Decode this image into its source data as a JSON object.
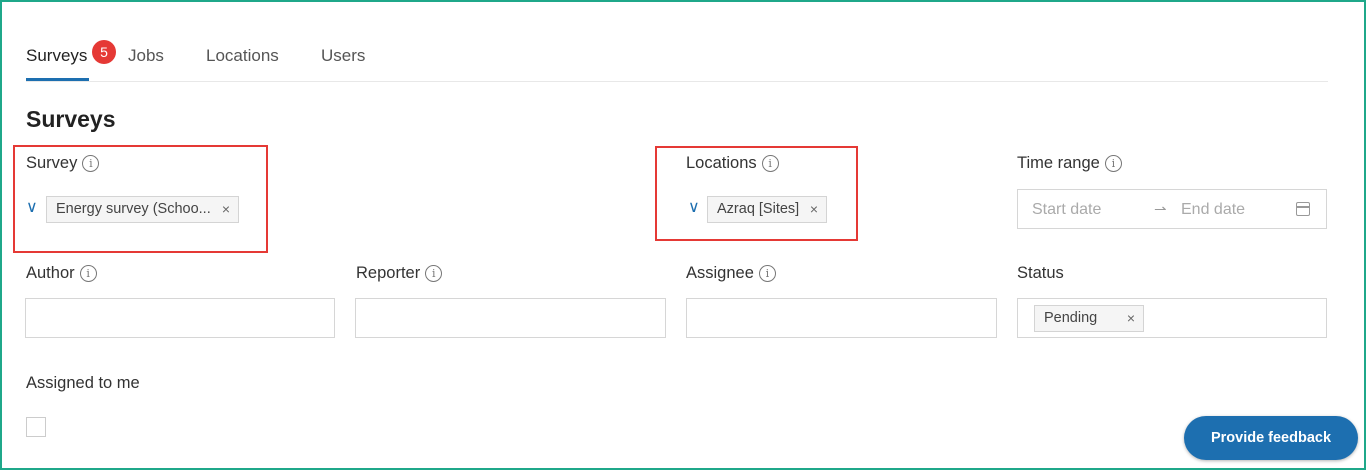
{
  "tabs": [
    {
      "label": "Surveys",
      "badge": "5",
      "active": true
    },
    {
      "label": "Jobs"
    },
    {
      "label": "Locations"
    },
    {
      "label": "Users"
    }
  ],
  "page_title": "Surveys",
  "filters": {
    "survey": {
      "label": "Survey",
      "selected": "Energy survey (Schoo...",
      "icon": "info-icon"
    },
    "locations": {
      "label": "Locations",
      "selected": "Azraq [Sites]",
      "icon": "info-icon"
    },
    "time_range": {
      "label": "Time range",
      "start_placeholder": "Start date",
      "end_placeholder": "End date",
      "icon": "calendar-icon"
    },
    "author": {
      "label": "Author",
      "value": ""
    },
    "reporter": {
      "label": "Reporter",
      "value": ""
    },
    "assignee": {
      "label": "Assignee",
      "value": ""
    },
    "status": {
      "label": "Status",
      "selected": "Pending"
    },
    "assigned_to_me": {
      "label": "Assigned to me",
      "checked": false
    }
  },
  "feedback_button": "Provide feedback",
  "colors": {
    "accent": "#1d6fb0",
    "badge": "#e53935",
    "highlight": "#e53935",
    "frame": "#1fa88a"
  }
}
